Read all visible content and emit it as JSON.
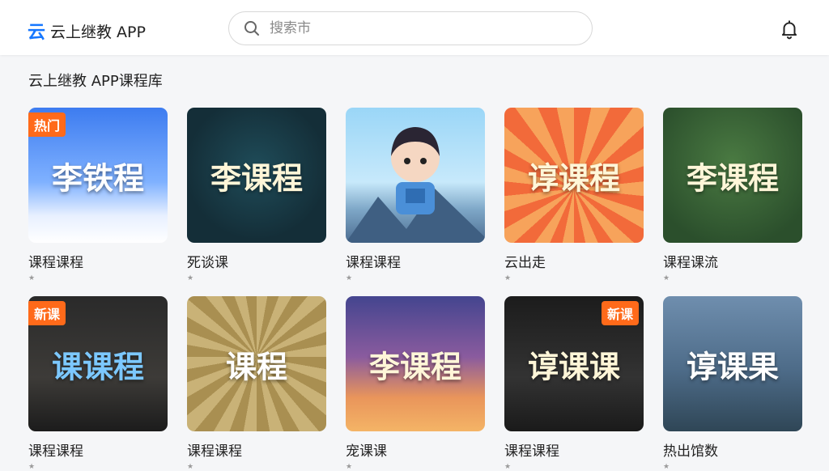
{
  "app": {
    "name": "云上继教 APP",
    "logo_glyph": "云"
  },
  "search": {
    "placeholder": "搜索市"
  },
  "icons": {
    "search": "search-icon",
    "bell": "bell-icon"
  },
  "section": {
    "title": "云上继教 APP课程库"
  },
  "colors": {
    "accent": "#1677ff",
    "badge": "#ff6a1a"
  },
  "courses": [
    {
      "title": "课程课程",
      "thumb_text": "李铁程",
      "badge": "热门",
      "rating": "★"
    },
    {
      "title": "死谈课",
      "thumb_text": "李课程",
      "badge": "",
      "rating": "★"
    },
    {
      "title": "课程课程",
      "thumb_text": "",
      "badge": "",
      "rating": "★"
    },
    {
      "title": "云出走",
      "thumb_text": "谆课程",
      "badge": "",
      "rating": "★"
    },
    {
      "title": "课程课流",
      "thumb_text": "李课程",
      "badge": "",
      "rating": "★"
    },
    {
      "title": "课程课程",
      "thumb_text": "课课程",
      "badge": "新课",
      "rating": "★"
    },
    {
      "title": "课程课程",
      "thumb_text": "课程",
      "badge": "",
      "rating": "★"
    },
    {
      "title": "宠课课",
      "thumb_text": "李课程",
      "badge": "",
      "rating": "★"
    },
    {
      "title": "课程课程",
      "thumb_text": "谆课课",
      "badge": "新课",
      "rating": "★"
    },
    {
      "title": "热出馆数",
      "thumb_text": "谆课果",
      "badge": "",
      "rating": "★"
    }
  ]
}
